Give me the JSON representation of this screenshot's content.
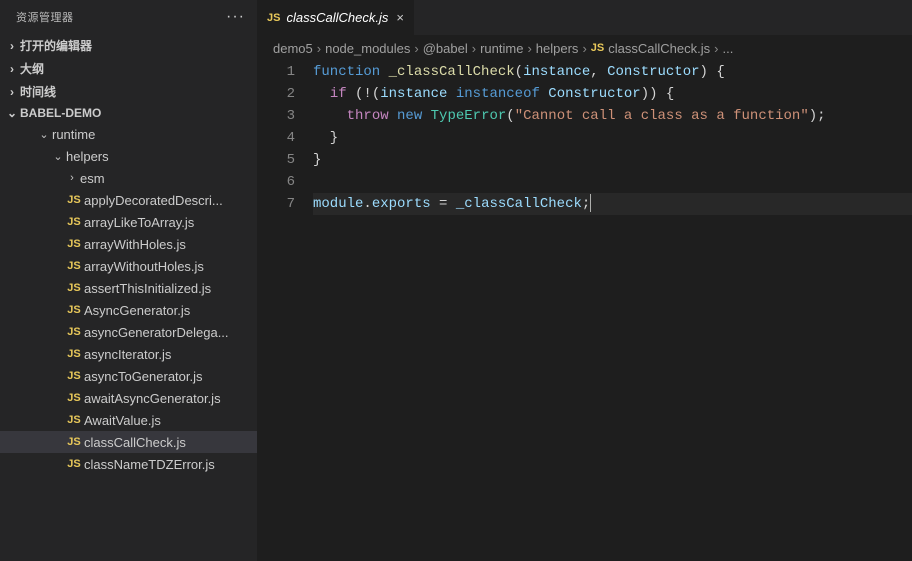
{
  "sidebar": {
    "title": "资源管理器",
    "sections": {
      "openEditors": "打开的编辑器",
      "outline": "大纲",
      "timeline": "时间线",
      "project": "BABEL-DEMO"
    },
    "tree": {
      "runtime": "runtime",
      "helpers": "helpers",
      "esm": "esm",
      "files": [
        "applyDecoratedDescri...",
        "arrayLikeToArray.js",
        "arrayWithHoles.js",
        "arrayWithoutHoles.js",
        "assertThisInitialized.js",
        "AsyncGenerator.js",
        "asyncGeneratorDelega...",
        "asyncIterator.js",
        "asyncToGenerator.js",
        "awaitAsyncGenerator.js",
        "AwaitValue.js",
        "classCallCheck.js",
        "classNameTDZError.js"
      ],
      "selectedIndex": 11
    }
  },
  "tab": {
    "icon": "JS",
    "name": "classCallCheck.js"
  },
  "breadcrumb": {
    "parts": [
      "demo5",
      "node_modules",
      "@babel",
      "runtime",
      "helpers"
    ],
    "fileIcon": "JS",
    "file": "classCallCheck.js",
    "more": "..."
  },
  "code": {
    "lineCount": 7,
    "tokens": {
      "l1": {
        "function": "function",
        "name": "_classCallCheck",
        "p1": "instance",
        "p2": "Constructor"
      },
      "l2": {
        "if": "if",
        "instanceof": "instanceof",
        "a": "instance",
        "b": "Constructor"
      },
      "l3": {
        "throw": "throw",
        "new": "new",
        "type": "TypeError",
        "str": "\"Cannot call a class as a function\""
      },
      "l7": {
        "mod": "module",
        "exp": "exports",
        "val": "_classCallCheck"
      }
    }
  }
}
